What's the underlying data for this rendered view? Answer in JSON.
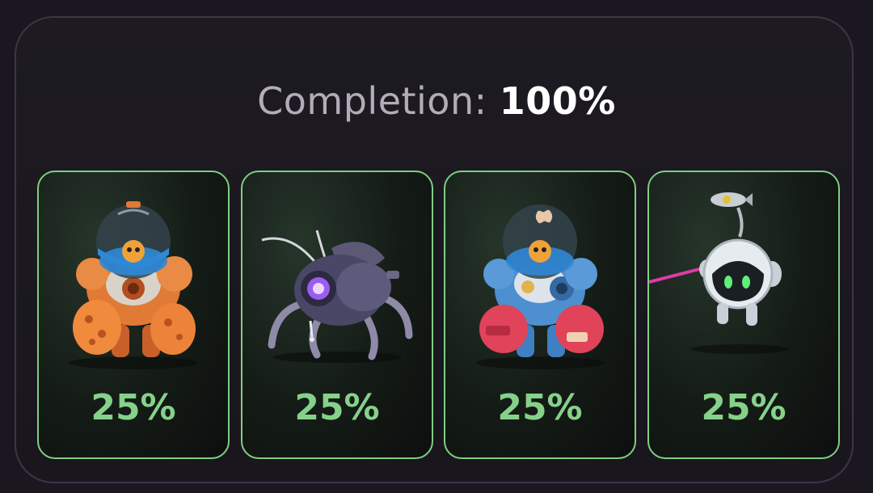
{
  "completion": {
    "label": "Completion:",
    "value": "100%"
  },
  "cards": [
    {
      "name": "orange-diver-robot",
      "percent": "25%"
    },
    {
      "name": "purple-spider-bot",
      "percent": "25%"
    },
    {
      "name": "blue-diver-robot",
      "percent": "25%"
    },
    {
      "name": "white-drone-bot",
      "percent": "25%"
    }
  ],
  "colors": {
    "accent": "#86d18a",
    "card_border": "#7ecf80",
    "background": "#1b1720"
  }
}
